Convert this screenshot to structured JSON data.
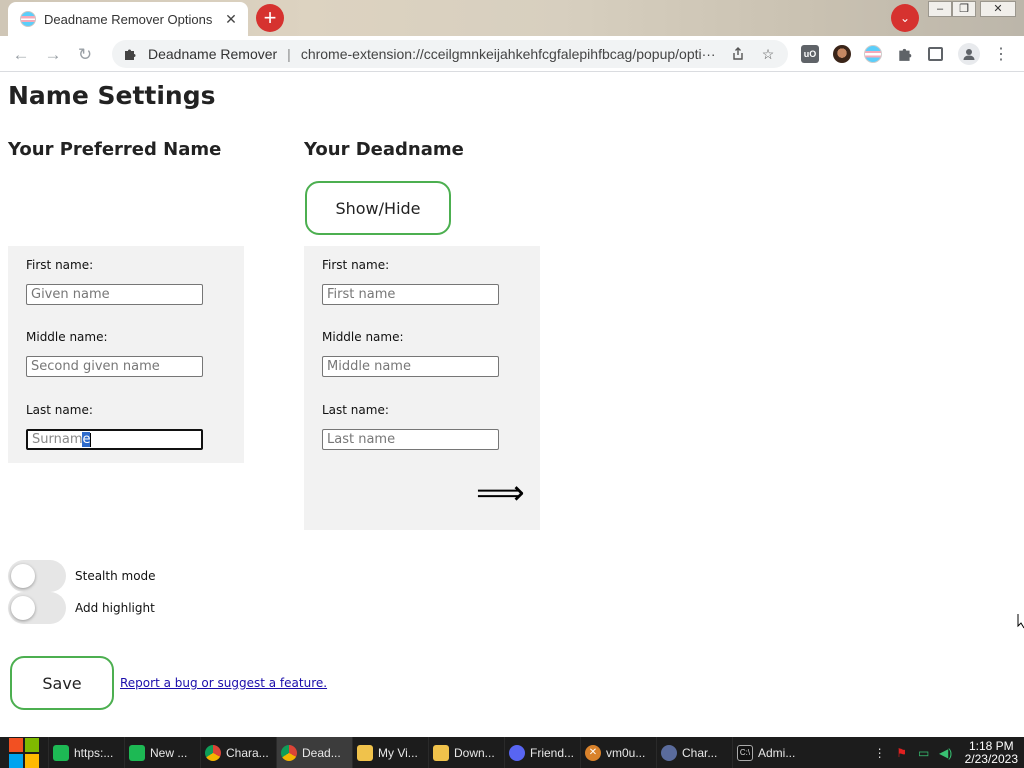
{
  "browser": {
    "tab_title": "Deadname Remover Options",
    "tab_close": "✕",
    "new_tab": "+",
    "tab_search": "⌄",
    "window_controls": {
      "minimize": "–",
      "maximize": "❐",
      "close": "✕"
    },
    "omnibox": {
      "site_name": "Deadname Remover",
      "separator": "|",
      "url": "chrome-extension://cceilgmnkeijahkehfcgfalepihfbcag/popup/opti···"
    }
  },
  "page": {
    "title": "Name Settings",
    "preferred": {
      "heading": "Your Preferred Name",
      "first_label": "First name:",
      "first_placeholder": "Given name",
      "middle_label": "Middle name:",
      "middle_placeholder": "Second given name",
      "last_label": "Last name:",
      "last_value_unselected": "Surnam",
      "last_value_selected": "e"
    },
    "deadname": {
      "heading": "Your Deadname",
      "show_hide_label": "Show/Hide",
      "first_label": "First name:",
      "first_placeholder": "First name",
      "middle_label": "Middle name:",
      "middle_placeholder": "Middle name",
      "last_label": "Last name:",
      "last_placeholder": "Last name",
      "arrow": "⟹"
    },
    "toggles": [
      {
        "label": "Stealth mode",
        "on": false
      },
      {
        "label": "Add highlight",
        "on": false
      }
    ],
    "save_label": "Save",
    "report_link": "Report a bug or suggest a feature."
  },
  "taskbar": {
    "items": [
      {
        "label": "https:...",
        "icon": "spotify-icon",
        "active": false
      },
      {
        "label": "New ...",
        "icon": "spotify-icon",
        "active": false
      },
      {
        "label": "Chara...",
        "icon": "chrome-icon",
        "active": false
      },
      {
        "label": "Dead...",
        "icon": "chrome-icon",
        "active": true
      },
      {
        "label": "My Vi...",
        "icon": "folder-icon",
        "active": false
      },
      {
        "label": "Down...",
        "icon": "folder-icon",
        "active": false
      },
      {
        "label": "Friend...",
        "icon": "discord-icon",
        "active": false
      },
      {
        "label": "vm0u...",
        "icon": "x-app-icon",
        "active": false
      },
      {
        "label": "Char...",
        "icon": "character-app-icon",
        "active": false
      },
      {
        "label": "Admi...",
        "icon": "cmd-icon",
        "active": false
      }
    ],
    "clock_time": "1:18 PM",
    "clock_date": "2/23/2023"
  },
  "colors": {
    "button_border": "#4caf50",
    "panel_bg": "#f2f2f2",
    "link": "#1a0dab",
    "selection": "#2e6bcb",
    "chrome_accent_red": "#d6322f"
  }
}
